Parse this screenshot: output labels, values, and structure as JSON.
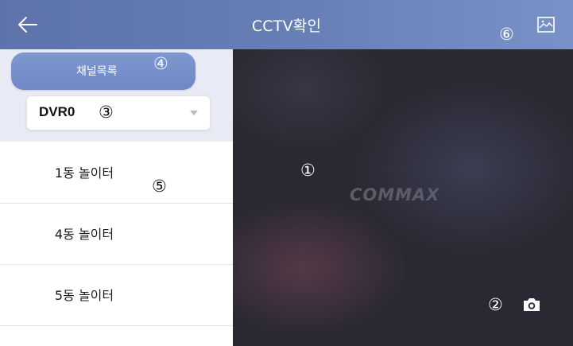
{
  "header": {
    "title": "CCTV확인",
    "back_icon": "back-arrow-icon",
    "gallery_icon": "gallery-image-icon"
  },
  "sidebar": {
    "channel_list_label": "채널목록",
    "dvr_select_value": "DVR0",
    "items": [
      {
        "label": "1동 놀이터"
      },
      {
        "label": "4동 놀이터"
      },
      {
        "label": "5동 놀이터"
      }
    ]
  },
  "video": {
    "logo": "COMMAX",
    "capture_icon": "camera-icon"
  },
  "markers": {
    "m1": "①",
    "m2": "②",
    "m3": "③",
    "m4": "④",
    "m5": "⑤",
    "m6": "⑥"
  },
  "colors": {
    "header": "#6780b6",
    "accent_button": "#7891cb",
    "sidebar_bg": "#e8ebf5",
    "video_bg": "#2a2933"
  }
}
